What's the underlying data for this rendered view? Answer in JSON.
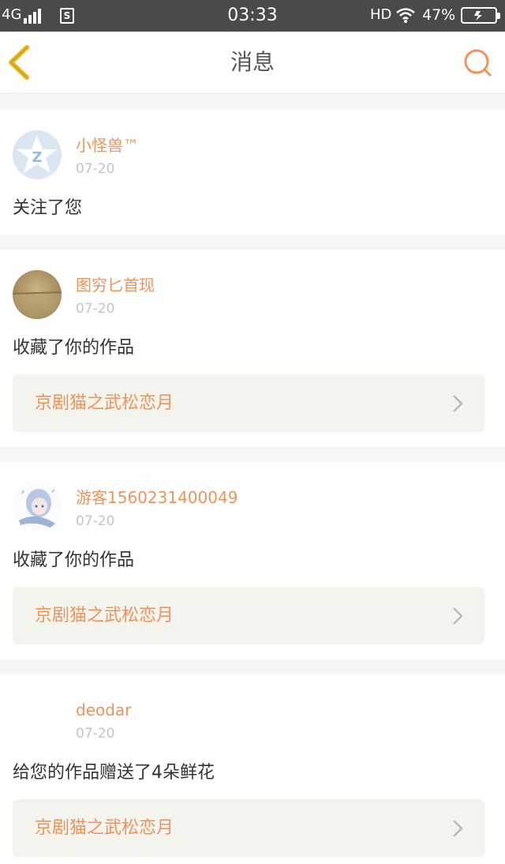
{
  "status_bar": {
    "network": "4G",
    "time": "03:33",
    "hd": "HD",
    "battery": "47%"
  },
  "header": {
    "title": "消息"
  },
  "messages": [
    {
      "username": "小怪兽™",
      "date": "07-20",
      "action": "关注了您",
      "avatar": "qq-star-icon"
    },
    {
      "username": "图穷匕首现",
      "date": "07-20",
      "action": "收藏了你的作品",
      "work_title": "京剧猫之武松恋月",
      "avatar": "landscape-avatar"
    },
    {
      "username": "游客1560231400049",
      "date": "07-20",
      "action": "收藏了你的作品",
      "work_title": "京剧猫之武松恋月",
      "avatar": "anime-girl-avatar"
    },
    {
      "username": "deodar",
      "date": "07-20",
      "action": "给您的作品赠送了4朵鲜花",
      "work_title": "京剧猫之武松恋月",
      "avatar": "blank-avatar"
    }
  ],
  "colors": {
    "accent": "#f0935a",
    "back_arrow": "#e7b80f"
  }
}
